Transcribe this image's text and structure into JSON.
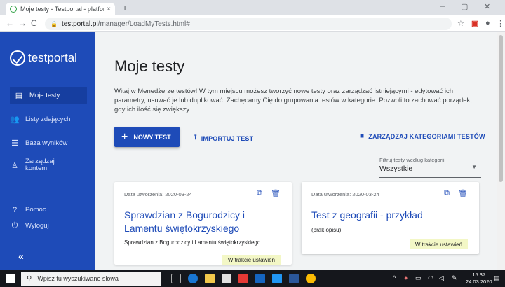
{
  "browser": {
    "tab_title": "Moje testy - Testportal - platform",
    "tab_close": "×",
    "new_tab": "+",
    "minimize": "–",
    "maximize": "▢",
    "close": "✕",
    "back": "←",
    "forward": "→",
    "reload": "C",
    "url_host": "testportal.pl",
    "url_path": "/manager/LoadMyTests.html#",
    "star": "☆",
    "profile": "●",
    "menu": "⋮"
  },
  "sidebar": {
    "logo_text": "testportal",
    "items": [
      {
        "label": "Moje testy",
        "icon": "list-icon"
      },
      {
        "label": "Listy zdających",
        "icon": "people-icon"
      },
      {
        "label": "Baza wyników",
        "icon": "table-icon"
      },
      {
        "label": "Zarządzaj kontem",
        "icon": "person-icon"
      },
      {
        "label": "Pomoc",
        "icon": "help-icon"
      },
      {
        "label": "Wyloguj",
        "icon": "power-icon"
      }
    ],
    "collapse": "«"
  },
  "main": {
    "title": "Moje testy",
    "intro": "Witaj w Menedżerze testów! W tym miejscu możesz tworzyć nowe testy oraz zarządzać istniejącymi - edytować ich parametry, usuwać je lub duplikować. Zachęcamy Cię do grupowania testów w kategorie. Pozwoli to zachować porządek, gdy ich ilość się zwiększy.",
    "new_test": "NOWY TEST",
    "import_test": "IMPORTUJ TEST",
    "manage_categories": "ZARZĄDZAJ KATEGORIAMI TESTÓW",
    "filter_label": "Filtruj testy według kategorii",
    "filter_value": "Wszystkie",
    "cards": [
      {
        "date": "Data utworzenia: 2020-03-24",
        "title": "Sprawdzian z Bogurodzicy i Lamentu świętokrzyskiego",
        "description": "Sprawdzian z Bogurodzicy i Lamentu świętokrzyskiego",
        "status": "W trakcie ustawień"
      },
      {
        "date": "Data utworzenia: 2020-03-24",
        "title": "Test z geografii - przykład",
        "description": "(brak opisu)",
        "status": "W trakcie ustawień"
      }
    ]
  },
  "taskbar": {
    "search_placeholder": "Wpisz tu wyszukiwane słowa",
    "time": "15:37",
    "date": "24.03.2020"
  },
  "colors": {
    "brand": "#1e4bb8",
    "status_bg": "#f3f7c6"
  }
}
